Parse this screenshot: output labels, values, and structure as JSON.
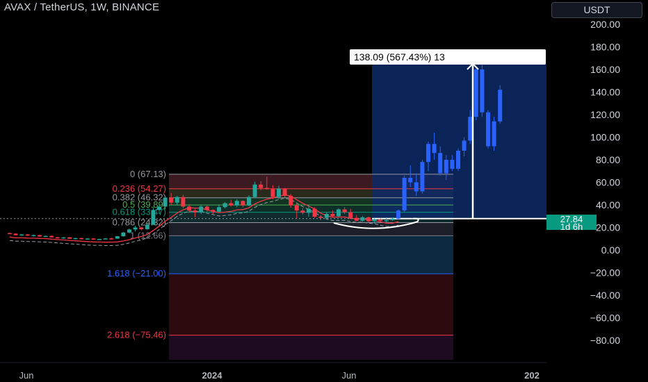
{
  "header": {
    "title": "AVAX / TetherUS, 1W, BINANCE",
    "currency": "USDT"
  },
  "price_badge": {
    "price": "27.84",
    "countdown": "1d 6h"
  },
  "measure": {
    "label": "138.09 (567.43%) 13",
    "from": 27.84,
    "to": 165
  },
  "colors": {
    "background": "#000000",
    "up": "#2962ff",
    "up_green": "#26a69a",
    "down": "#f23645",
    "projection_box": "#0d2a66",
    "current_price": "#089981"
  },
  "chart_data": {
    "type": "candlestick",
    "symbol": "AVAX / TetherUS",
    "interval": "1W",
    "exchange": "BINANCE",
    "y_axis": {
      "ylim": [
        -95,
        210
      ],
      "ticks": [
        "200.00",
        "180.00",
        "160.00",
        "140.00",
        "120.00",
        "100.00",
        "80.00",
        "60.00",
        "40.00",
        "20.00",
        "0.00",
        "−20.00",
        "−40.00",
        "−60.00",
        "−80.00"
      ],
      "tick_values": [
        200,
        180,
        160,
        140,
        120,
        100,
        80,
        60,
        40,
        20,
        0,
        -20,
        -40,
        -60,
        -80
      ]
    },
    "x_axis": {
      "ticks": [
        "Jun",
        "2024",
        "Jun",
        "202"
      ]
    },
    "fibonacci": [
      {
        "label": "0 (67.13)",
        "level": 0,
        "price": 67.13,
        "color": "#9598a1"
      },
      {
        "label": "0.236 (54.27)",
        "level": 0.236,
        "price": 54.27,
        "color": "#f23645"
      },
      {
        "label": "0.382 (46.32)",
        "level": 0.382,
        "price": 46.32,
        "color": "#9598a1"
      },
      {
        "label": "0.5 (39.89)",
        "level": 0.5,
        "price": 39.89,
        "color": "#4caf50"
      },
      {
        "label": "0.618 (33.47)",
        "level": 0.618,
        "price": 33.47,
        "color": "#089981"
      },
      {
        "label": "0.786 (24.32)",
        "level": 0.786,
        "price": 24.32,
        "color": "#9598a1"
      },
      {
        "label": "1 (12.66)",
        "level": 1,
        "price": 12.66,
        "color": "#787b86"
      },
      {
        "label": "1.618 (−21.00)",
        "level": 1.618,
        "price": -21.0,
        "color": "#2962ff"
      },
      {
        "label": "2.618 (−75.46)",
        "level": 2.618,
        "price": -75.46,
        "color": "#f23645"
      }
    ],
    "candles": [
      [
        15.0,
        15.5,
        14.2,
        14.5
      ],
      [
        14.5,
        14.9,
        13.0,
        13.2
      ],
      [
        13.2,
        14.0,
        12.8,
        13.8
      ],
      [
        13.8,
        14.2,
        12.5,
        12.8
      ],
      [
        12.8,
        13.5,
        12.0,
        13.2
      ],
      [
        13.2,
        13.6,
        11.8,
        12.0
      ],
      [
        12.0,
        12.8,
        11.5,
        12.5
      ],
      [
        12.5,
        13.0,
        11.0,
        11.3
      ],
      [
        11.3,
        11.8,
        10.2,
        10.5
      ],
      [
        10.5,
        11.5,
        10.0,
        11.2
      ],
      [
        11.2,
        11.6,
        9.8,
        10.0
      ],
      [
        10.0,
        10.8,
        9.5,
        10.6
      ],
      [
        10.6,
        11.0,
        9.4,
        9.6
      ],
      [
        9.6,
        10.4,
        9.2,
        10.2
      ],
      [
        10.2,
        10.6,
        9.0,
        9.3
      ],
      [
        9.3,
        10.0,
        8.9,
        9.8
      ],
      [
        9.8,
        10.5,
        9.5,
        10.3
      ],
      [
        10.3,
        11.0,
        9.9,
        10.1
      ],
      [
        10.1,
        12.5,
        10.0,
        12.2
      ],
      [
        12.2,
        16.0,
        11.8,
        15.5
      ],
      [
        15.5,
        19.0,
        14.8,
        18.2
      ],
      [
        18.2,
        21.5,
        16.5,
        20.0
      ],
      [
        20.0,
        20.5,
        17.5,
        18.5
      ],
      [
        18.5,
        24.0,
        18.0,
        22.5
      ],
      [
        22.5,
        38.0,
        22.0,
        35.5
      ],
      [
        35.5,
        40.0,
        32.0,
        38.5
      ],
      [
        38.5,
        48.0,
        36.0,
        46.5
      ],
      [
        46.5,
        50.5,
        40.0,
        42.0
      ],
      [
        42.0,
        48.0,
        39.5,
        47.0
      ],
      [
        47.0,
        49.0,
        37.0,
        38.5
      ],
      [
        38.5,
        40.5,
        33.0,
        35.0
      ],
      [
        35.0,
        36.5,
        29.0,
        33.5
      ],
      [
        33.5,
        40.0,
        32.0,
        38.5
      ],
      [
        38.5,
        39.5,
        34.0,
        35.5
      ],
      [
        35.5,
        36.0,
        32.0,
        34.0
      ],
      [
        34.0,
        40.0,
        33.5,
        38.0
      ],
      [
        38.0,
        42.5,
        37.0,
        41.5
      ],
      [
        41.5,
        44.5,
        38.5,
        39.5
      ],
      [
        39.5,
        45.0,
        38.0,
        43.5
      ],
      [
        43.5,
        44.0,
        38.0,
        39.5
      ],
      [
        39.5,
        48.5,
        38.8,
        47.0
      ],
      [
        47.0,
        60.5,
        46.0,
        58.0
      ],
      [
        58.0,
        61.0,
        53.0,
        55.0
      ],
      [
        55.0,
        65.0,
        53.5,
        54.0
      ],
      [
        54.0,
        57.5,
        45.0,
        47.0
      ],
      [
        47.0,
        57.0,
        45.5,
        54.5
      ],
      [
        54.5,
        55.0,
        46.0,
        48.0
      ],
      [
        48.0,
        49.5,
        37.5,
        39.5
      ],
      [
        39.5,
        41.0,
        28.0,
        35.0
      ],
      [
        35.0,
        37.0,
        31.5,
        33.0
      ],
      [
        33.0,
        40.0,
        29.5,
        36.5
      ],
      [
        36.5,
        38.0,
        28.5,
        29.5
      ],
      [
        29.5,
        31.0,
        26.5,
        28.5
      ],
      [
        28.5,
        33.5,
        28.0,
        32.0
      ],
      [
        32.0,
        35.0,
        29.0,
        30.0
      ],
      [
        30.0,
        37.0,
        29.5,
        36.0
      ],
      [
        36.0,
        38.0,
        32.0,
        33.5
      ],
      [
        33.5,
        36.5,
        27.5,
        28.5
      ],
      [
        28.5,
        31.0,
        25.5,
        26.0
      ],
      [
        26.0,
        30.0,
        25.0,
        29.0
      ],
      [
        29.0,
        29.5,
        24.5,
        25.5
      ],
      [
        25.5,
        28.0,
        23.5,
        27.0
      ],
      [
        27.0,
        28.0,
        25.0,
        25.8
      ],
      [
        25.8,
        29.0,
        24.0,
        26.5
      ],
      [
        26.5,
        28.8,
        26.0,
        27.84
      ],
      [
        27.84,
        36.0,
        27.0,
        35.0
      ],
      [
        35.0,
        66.0,
        34.0,
        64.0
      ],
      [
        64.0,
        75.0,
        56.0,
        60.0
      ],
      [
        60.0,
        68.0,
        48.0,
        52.0
      ],
      [
        52.0,
        80.0,
        50.0,
        78.0
      ],
      [
        78.0,
        96.0,
        70.0,
        94.0
      ],
      [
        94.0,
        104.0,
        80.0,
        86.0
      ],
      [
        86.0,
        92.0,
        66.0,
        68.0
      ],
      [
        68.0,
        84.0,
        62.0,
        80.0
      ],
      [
        80.0,
        84.0,
        70.0,
        72.0
      ],
      [
        72.0,
        90.0,
        70.0,
        88.0
      ],
      [
        88.0,
        100.0,
        83.0,
        97.0
      ],
      [
        97.0,
        124.0,
        94.0,
        118.0
      ],
      [
        118.0,
        163.0,
        115.0,
        160.0
      ],
      [
        160.0,
        166.0,
        118.0,
        122.0
      ],
      [
        122.0,
        124.0,
        90.0,
        92.0
      ],
      [
        92.0,
        118.0,
        88.0,
        114.0
      ],
      [
        114.0,
        146.0,
        112.0,
        142.0
      ]
    ]
  }
}
